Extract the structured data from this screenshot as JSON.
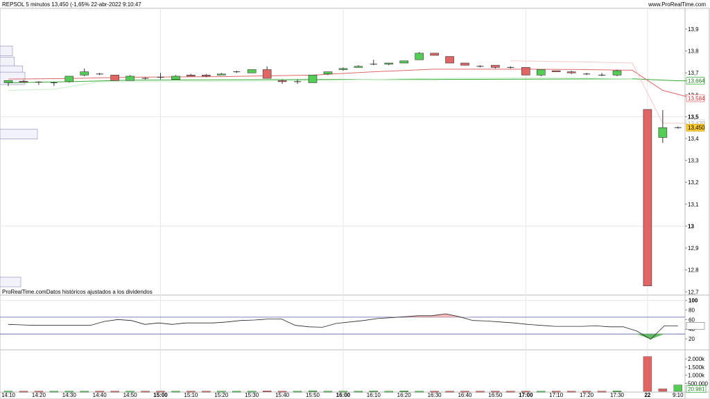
{
  "header": {
    "title": "REPSOL 5 minutos 13,450 (-1,65% 22-abr-2022 9:10:47",
    "site": "www.ProRealTime.com"
  },
  "note": "ProRealTime.comDatos históricos ajustados a los dividendos",
  "colors": {
    "up": "#55cc55",
    "down": "#e06666",
    "ma_slow": "#33aa33",
    "ma_fast": "#f0a0a0",
    "indicator": "#222222",
    "bands": "#5555aa",
    "profile": "#ccccee"
  },
  "chart_data": [
    {
      "type": "candlestick",
      "price_axis": {
        "ticks": [
          "13,9",
          "13,8",
          "13,7",
          "13,6",
          "13,5",
          "13,4",
          "13,3",
          "13,2",
          "13,1",
          "13",
          "12,9",
          "12,8",
          "12,7"
        ],
        "tick_values": [
          13.9,
          13.8,
          13.7,
          13.6,
          13.5,
          13.4,
          13.3,
          13.2,
          13.1,
          13.0,
          12.9,
          12.8,
          12.7
        ],
        "bold_ticks": [
          "13,5",
          "13"
        ],
        "ylim": [
          12.685,
          13.995
        ]
      },
      "time_axis": {
        "labels": [
          "14:10",
          "14:20",
          "14:30",
          "14:40",
          "14:50",
          "15:00",
          "15:10",
          "15:20",
          "15:30",
          "15:40",
          "15:50",
          "16:00",
          "16:10",
          "16:20",
          "16:30",
          "16:40",
          "16:50",
          "17:00",
          "17:10",
          "17:20",
          "17:30",
          "22",
          "9:10"
        ],
        "label_index": [
          0,
          2,
          4,
          6,
          8,
          10,
          12,
          14,
          16,
          18,
          20,
          22,
          24,
          26,
          28,
          30,
          32,
          34,
          36,
          38,
          40,
          42,
          44
        ],
        "bold_labels": [
          "15:00",
          "16:00",
          "17:00",
          "22"
        ]
      },
      "candles": [
        {
          "o": 13.655,
          "h": 13.665,
          "l": 13.64,
          "c": 13.665
        },
        {
          "o": 13.662,
          "h": 13.668,
          "l": 13.655,
          "c": 13.658
        },
        {
          "o": 13.658,
          "h": 13.662,
          "l": 13.645,
          "c": 13.655
        },
        {
          "o": 13.655,
          "h": 13.66,
          "l": 13.64,
          "c": 13.655
        },
        {
          "o": 13.66,
          "h": 13.685,
          "l": 13.655,
          "c": 13.685
        },
        {
          "o": 13.69,
          "h": 13.72,
          "l": 13.685,
          "c": 13.705
        },
        {
          "o": 13.695,
          "h": 13.7,
          "l": 13.69,
          "c": 13.695
        },
        {
          "o": 13.69,
          "h": 13.69,
          "l": 13.665,
          "c": 13.665
        },
        {
          "o": 13.665,
          "h": 13.69,
          "l": 13.665,
          "c": 13.685
        },
        {
          "o": 13.675,
          "h": 13.68,
          "l": 13.67,
          "c": 13.675
        },
        {
          "o": 13.68,
          "h": 13.7,
          "l": 13.67,
          "c": 13.68
        },
        {
          "o": 13.67,
          "h": 13.69,
          "l": 13.67,
          "c": 13.685
        },
        {
          "o": 13.69,
          "h": 13.695,
          "l": 13.685,
          "c": 13.685
        },
        {
          "o": 13.69,
          "h": 13.695,
          "l": 13.68,
          "c": 13.685
        },
        {
          "o": 13.69,
          "h": 13.7,
          "l": 13.69,
          "c": 13.695
        },
        {
          "o": 13.705,
          "h": 13.71,
          "l": 13.7,
          "c": 13.705
        },
        {
          "o": 13.7,
          "h": 13.715,
          "l": 13.7,
          "c": 13.715
        },
        {
          "o": 13.715,
          "h": 13.73,
          "l": 13.675,
          "c": 13.675
        },
        {
          "o": 13.665,
          "h": 13.67,
          "l": 13.65,
          "c": 13.66
        },
        {
          "o": 13.66,
          "h": 13.67,
          "l": 13.65,
          "c": 13.66
        },
        {
          "o": 13.655,
          "h": 13.69,
          "l": 13.655,
          "c": 13.69
        },
        {
          "o": 13.695,
          "h": 13.705,
          "l": 13.69,
          "c": 13.705
        },
        {
          "o": 13.715,
          "h": 13.725,
          "l": 13.71,
          "c": 13.72
        },
        {
          "o": 13.725,
          "h": 13.735,
          "l": 13.725,
          "c": 13.73
        },
        {
          "o": 13.74,
          "h": 13.76,
          "l": 13.735,
          "c": 13.74
        },
        {
          "o": 13.74,
          "h": 13.745,
          "l": 13.735,
          "c": 13.745
        },
        {
          "o": 13.745,
          "h": 13.755,
          "l": 13.745,
          "c": 13.755
        },
        {
          "o": 13.76,
          "h": 13.795,
          "l": 13.76,
          "c": 13.79
        },
        {
          "o": 13.79,
          "h": 13.79,
          "l": 13.78,
          "c": 13.78
        },
        {
          "o": 13.775,
          "h": 13.775,
          "l": 13.745,
          "c": 13.745
        },
        {
          "o": 13.745,
          "h": 13.745,
          "l": 13.735,
          "c": 13.735
        },
        {
          "o": 13.73,
          "h": 13.735,
          "l": 13.725,
          "c": 13.73
        },
        {
          "o": 13.735,
          "h": 13.735,
          "l": 13.72,
          "c": 13.725
        },
        {
          "o": 13.725,
          "h": 13.73,
          "l": 13.72,
          "c": 13.725
        },
        {
          "o": 13.725,
          "h": 13.725,
          "l": 13.69,
          "c": 13.69
        },
        {
          "o": 13.69,
          "h": 13.715,
          "l": 13.685,
          "c": 13.715
        },
        {
          "o": 13.71,
          "h": 13.71,
          "l": 13.705,
          "c": 13.705
        },
        {
          "o": 13.705,
          "h": 13.71,
          "l": 13.695,
          "c": 13.7
        },
        {
          "o": 13.695,
          "h": 13.7,
          "l": 13.69,
          "c": 13.695
        },
        {
          "o": 13.69,
          "h": 13.7,
          "l": 13.685,
          "c": 13.69
        },
        {
          "o": 13.69,
          "h": 13.715,
          "l": 13.685,
          "c": 13.71
        },
        {
          "o": null,
          "h": null,
          "l": null,
          "c": null
        },
        {
          "o": 13.533,
          "h": 13.533,
          "l": 12.727,
          "c": 12.727
        },
        {
          "o": 13.405,
          "h": 13.53,
          "l": 13.38,
          "c": 13.45
        },
        {
          "o": 13.45,
          "h": 13.455,
          "l": 13.445,
          "c": 13.45
        }
      ],
      "moving_averages": [
        {
          "color": "#33aa33",
          "values": [
            [
              0,
              13.655
            ],
            [
              4,
              13.66
            ],
            [
              8,
              13.667
            ],
            [
              14,
              13.668
            ],
            [
              20,
              13.67
            ],
            [
              28,
              13.67
            ],
            [
              36,
              13.672
            ],
            [
              41,
              13.673
            ],
            [
              42,
              13.67
            ],
            [
              44,
              13.664
            ],
            [
              45,
              13.664
            ]
          ]
        },
        {
          "color": "#e06666",
          "values": [
            [
              0,
              13.672
            ],
            [
              4,
              13.674
            ],
            [
              8,
              13.68
            ],
            [
              14,
              13.683
            ],
            [
              20,
              13.69
            ],
            [
              24,
              13.705
            ],
            [
              28,
              13.717
            ],
            [
              34,
              13.717
            ],
            [
              38,
              13.715
            ],
            [
              41,
              13.712
            ],
            [
              43,
              13.62
            ],
            [
              45,
              13.584
            ]
          ]
        },
        {
          "color": "#f7c8c8",
          "values": [
            [
              33,
              13.755
            ],
            [
              38,
              13.75
            ],
            [
              41,
              13.745
            ],
            [
              43,
              13.47
            ],
            [
              45,
              13.47
            ]
          ]
        },
        {
          "color": "#c8eec8",
          "values": [
            [
              0,
              13.62
            ],
            [
              3,
              13.625
            ],
            [
              6,
              13.66
            ],
            [
              11,
              13.66
            ],
            [
              20,
              13.665
            ],
            [
              28,
              13.675
            ],
            [
              36,
              13.678
            ],
            [
              41,
              13.673
            ]
          ]
        }
      ],
      "price_tags": [
        {
          "text": "13,664",
          "value": 13.664,
          "style": "green"
        },
        {
          "text": "13,584",
          "value": 13.584,
          "style": "red"
        },
        {
          "text": "13,470",
          "value": 13.47,
          "style": "grey"
        },
        {
          "text": "13,450",
          "value": 13.45,
          "style": "gold"
        }
      ],
      "volume_profile": [
        {
          "price": 13.8,
          "length": 0.3
        },
        {
          "price": 13.75,
          "length": 0.34
        },
        {
          "price": 13.71,
          "length": 0.54
        },
        {
          "price": 13.675,
          "length": 0.6
        },
        {
          "price": 13.42,
          "length": 0.9
        },
        {
          "price": 12.745,
          "length": 0.5
        }
      ]
    },
    {
      "type": "line",
      "axis": {
        "ticks": [
          "100",
          "80",
          "60",
          "40",
          "20"
        ],
        "tick_values": [
          100,
          80,
          60,
          40,
          20
        ],
        "bold_ticks": [
          "100"
        ],
        "ylim": [
          0,
          108
        ]
      },
      "bands": [
        65,
        30
      ],
      "last_value_label": "44,732",
      "values": [
        50,
        49,
        48,
        48,
        48,
        48,
        48,
        56,
        60,
        58,
        50,
        53,
        50,
        53,
        53,
        53,
        55,
        58,
        59,
        61,
        61,
        48,
        45,
        44,
        52,
        55,
        58,
        62,
        64,
        66,
        68,
        68,
        72,
        66,
        58,
        57,
        55,
        53,
        50,
        48,
        46,
        46,
        46,
        47,
        45,
        45,
        36,
        19,
        47,
        47
      ]
    },
    {
      "type": "bar",
      "axis": {
        "ticks": [
          "2.000k",
          "1.500k",
          "1.000k",
          "500.000"
        ],
        "tick_values": [
          2000,
          1500,
          1000,
          500
        ],
        "last_value_label": "20.981",
        "ylim": [
          0,
          2350
        ]
      },
      "values": [
        {
          "v": 15,
          "up": true
        },
        {
          "v": 15,
          "up": false
        },
        {
          "v": 15,
          "up": false
        },
        {
          "v": 15,
          "up": true
        },
        {
          "v": 15,
          "up": true
        },
        {
          "v": 15,
          "up": true
        },
        {
          "v": 15,
          "up": false
        },
        {
          "v": 15,
          "up": false
        },
        {
          "v": 15,
          "up": true
        },
        {
          "v": 15,
          "up": false
        },
        {
          "v": 15,
          "up": false
        },
        {
          "v": 15,
          "up": true
        },
        {
          "v": 15,
          "up": false
        },
        {
          "v": 15,
          "up": false
        },
        {
          "v": 15,
          "up": true
        },
        {
          "v": 15,
          "up": true
        },
        {
          "v": 15,
          "up": true
        },
        {
          "v": 30,
          "up": false
        },
        {
          "v": 15,
          "up": false
        },
        {
          "v": 15,
          "up": true
        },
        {
          "v": 40,
          "up": true
        },
        {
          "v": 15,
          "up": true
        },
        {
          "v": 15,
          "up": true
        },
        {
          "v": 15,
          "up": true
        },
        {
          "v": 25,
          "up": true
        },
        {
          "v": 15,
          "up": true
        },
        {
          "v": 30,
          "up": true
        },
        {
          "v": 15,
          "up": true
        },
        {
          "v": 15,
          "up": false
        },
        {
          "v": 15,
          "up": false
        },
        {
          "v": 15,
          "up": false
        },
        {
          "v": 15,
          "up": false
        },
        {
          "v": 15,
          "up": false
        },
        {
          "v": 15,
          "up": false
        },
        {
          "v": 15,
          "up": false
        },
        {
          "v": 15,
          "up": true
        },
        {
          "v": 15,
          "up": false
        },
        {
          "v": 15,
          "up": false
        },
        {
          "v": 15,
          "up": false
        },
        {
          "v": 15,
          "up": false
        },
        {
          "v": 35,
          "up": true
        },
        {
          "v": null,
          "up": false
        },
        {
          "v": 2150,
          "up": false
        },
        {
          "v": 160,
          "up": false
        },
        {
          "v": 400,
          "up": true
        },
        {
          "v": 30,
          "up": false
        }
      ]
    }
  ]
}
